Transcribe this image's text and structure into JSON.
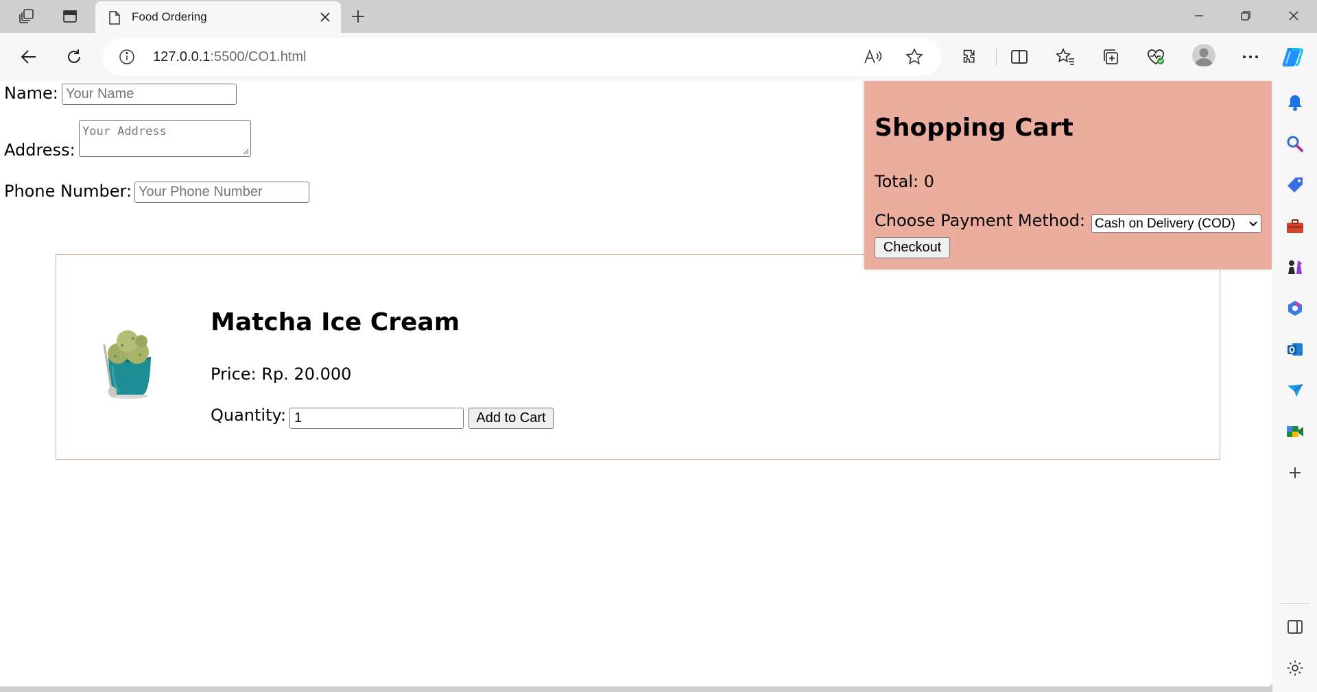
{
  "browser": {
    "tab": {
      "title": "Food Ordering"
    },
    "address": {
      "host": "127.0.0.1",
      "path": ":5500/CO1.html"
    }
  },
  "form": {
    "name": {
      "label": "Name:",
      "placeholder": "Your Name"
    },
    "address": {
      "label": "Address:",
      "placeholder": "Your Address"
    },
    "phone": {
      "label": "Phone Number:",
      "placeholder": "Your Phone Number"
    }
  },
  "product": {
    "name": "Matcha Ice Cream",
    "price": "Price: Rp. 20.000",
    "quantity_label": "Quantity:",
    "quantity_value": "1",
    "add_button": "Add to Cart"
  },
  "cart": {
    "title": "Shopping Cart",
    "total": "Total: 0",
    "payment_label": "Choose Payment Method:",
    "payment_selected": "Cash on Delivery (COD)",
    "checkout_button": "Checkout"
  },
  "colors": {
    "cart_background": "#eaad9e",
    "product_border": "#e8a9a0",
    "copilot_accent": "#1e90ff"
  }
}
